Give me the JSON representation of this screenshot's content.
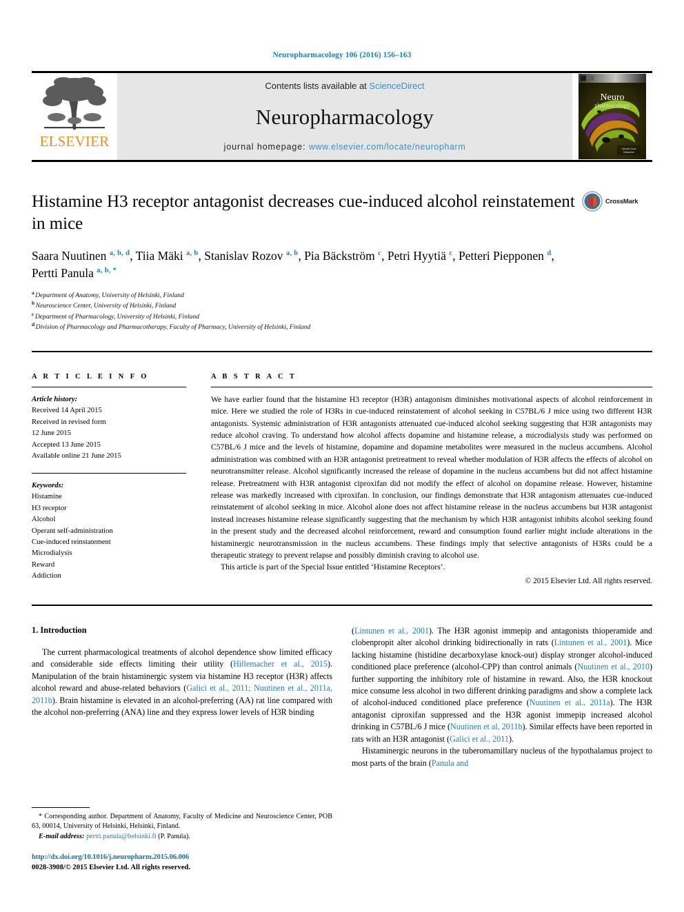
{
  "running_head": "Neuropharmacology 106 (2016) 156–163",
  "masthead": {
    "publisher_name": "ELSEVIER",
    "contents_prefix": "Contents lists available at ",
    "contents_link": "ScienceDirect",
    "journal_name": "Neuropharmacology",
    "homepage_prefix": "journal homepage: ",
    "homepage_url": "www.elsevier.com/locate/neuropharm",
    "cover_title_line1": "Neuro",
    "cover_title_line2": "pharmacology"
  },
  "article": {
    "title": "Histamine H3 receptor antagonist decreases cue-induced alcohol reinstatement in mice",
    "crossmark_label": "CrossMark",
    "authors": [
      {
        "name": "Saara Nuutinen",
        "marks": "a, b, d",
        "sep": ", "
      },
      {
        "name": "Tiia Mäki",
        "marks": "a, b",
        "sep": ", "
      },
      {
        "name": "Stanislav Rozov",
        "marks": "a, b",
        "sep": ", "
      },
      {
        "name": "Pia Bäckström",
        "marks": "c",
        "sep": ", "
      },
      {
        "name": "Petri Hyytiä",
        "marks": "c",
        "sep": ", "
      },
      {
        "name": "Petteri Piepponen",
        "marks": "d",
        "sep": ", "
      },
      {
        "name": "Pertti Panula",
        "marks": "a, b, *",
        "sep": ""
      }
    ],
    "affiliations": [
      {
        "mark": "a",
        "text": "Department of Anatomy, University of Helsinki, Finland"
      },
      {
        "mark": "b",
        "text": "Neuroscience Center, University of Helsinki, Finland"
      },
      {
        "mark": "c",
        "text": "Department of Pharmacology, University of Helsinki, Finland"
      },
      {
        "mark": "d",
        "text": "Division of Pharmacology and Pharmacotherapy, Faculty of Pharmacy, University of Helsinki, Finland"
      }
    ]
  },
  "article_info": {
    "label": "A R T I C L E   I N F O",
    "history_heading": "Article history:",
    "history": [
      "Received 14 April 2015",
      "Received in revised form",
      "12 June 2015",
      "Accepted 13 June 2015",
      "Available online 21 June 2015"
    ],
    "keywords_heading": "Keywords:",
    "keywords": [
      "Histamine",
      "H3 receptor",
      "Alcohol",
      "Operant self-administration",
      "Cue-induced reinstatement",
      "Microdialysis",
      "Reward",
      "Addiction"
    ]
  },
  "abstract": {
    "label": "A B S T R A C T",
    "paragraph1": "We have earlier found that the histamine H3 receptor (H3R) antagonism diminishes motivational aspects of alcohol reinforcement in mice. Here we studied the role of H3Rs in cue-induced reinstatement of alcohol seeking in C57BL/6 J mice using two different H3R antagonists. Systemic administration of H3R antagonists attenuated cue-induced alcohol seeking suggesting that H3R antagonists may reduce alcohol craving. To understand how alcohol affects dopamine and histamine release, a microdialysis study was performed on C57BL/6 J mice and the levels of histamine, dopamine and dopamine metabolites were measured in the nucleus accumbens. Alcohol administration was combined with an H3R antagonist pretreatment to reveal whether modulation of H3R affects the effects of alcohol on neurotransmitter release. Alcohol significantly increased the release of dopamine in the nucleus accumbens but did not affect histamine release. Pretreatment with H3R antagonist ciproxifan did not modify the effect of alcohol on dopamine release. However, histamine release was markedly increased with ciproxifan. In conclusion, our findings demonstrate that H3R antagonism attenuates cue-induced reinstatement of alcohol seeking in mice. Alcohol alone does not affect histamine release in the nucleus accumbens but H3R antagonist instead increases histamine release significantly suggesting that the mechanism by which H3R antagonist inhibits alcohol seeking found in the present study and the decreased alcohol reinforcement, reward and consumption found earlier might include alterations in the histaminergic neurotransmission in the nucleus accumbens. These findings imply that selective antagonists of H3Rs could be a therapeutic strategy to prevent relapse and possibly diminish craving to alcohol use.",
    "paragraph2": "This article is part of the Special Issue entitled ‘Histamine Receptors’.",
    "copyright": "© 2015 Elsevier Ltd. All rights reserved."
  },
  "introduction": {
    "heading": "1. Introduction",
    "left_col": [
      {
        "t": "The current pharmacological treatments of alcohol dependence show limited efficacy and considerable side effects limiting their utility (",
        "c": ""
      },
      {
        "t": "",
        "c": "Hillemacher et al., 2015"
      },
      {
        "t": "). Manipulation of the brain histaminergic system via histamine H3 receptor (H3R) affects alcohol reward and abuse-related behaviors (",
        "c": ""
      },
      {
        "t": "",
        "c": "Galici et al., 2011; Nuutinen et al., 2011a, 2011b"
      },
      {
        "t": "). Brain histamine is elevated in an alcohol-preferring (AA) rat line compared with the alcohol non-preferring (ANA) line and they express lower levels of H3R binding",
        "c": ""
      }
    ],
    "right_col": [
      {
        "t": "(",
        "c": ""
      },
      {
        "t": "",
        "c": "Lintunen et al., 2001"
      },
      {
        "t": "). The H3R agonist immepip and antagonists thioperamide and clobenpropit alter alcohol drinking bidirectionally in rats (",
        "c": ""
      },
      {
        "t": "",
        "c": "Lintunen et al., 2001"
      },
      {
        "t": "). Mice lacking histamine (histidine decarboxylase knock-out) display stronger alcohol-induced conditioned place preference (alcohol-CPP) than control animals (",
        "c": ""
      },
      {
        "t": "",
        "c": "Nuutinen et al., 2010"
      },
      {
        "t": ") further supporting the inhibitory role of histamine in reward. Also, the H3R knockout mice consume less alcohol in two different drinking paradigms and show a complete lack of alcohol-induced conditioned place preference (",
        "c": ""
      },
      {
        "t": "",
        "c": "Nuutinen et al., 2011a"
      },
      {
        "t": "). The H3R antagonist ciproxifan suppressed and the H3R agonist immepip increased alcohol drinking in C57BL/6 J mice (",
        "c": ""
      },
      {
        "t": "",
        "c": "Nuutinen et al, 2011b"
      },
      {
        "t": "). Similar effects have been reported in rats with an H3R antagonist (",
        "c": ""
      },
      {
        "t": "",
        "c": "Galici et al., 2011"
      },
      {
        "t": ").",
        "c": ""
      }
    ],
    "right_col_p2": [
      {
        "t": "Histaminergic neurons in the tuberomamillary nucleus of the hypothalamus project to most parts of the brain (",
        "c": ""
      },
      {
        "t": "",
        "c": "Panula and"
      }
    ]
  },
  "footnote": {
    "corresponding": "* Corresponding author. Department of Anatomy, Faculty of Medicine and Neuroscience Center, POB 63, 00014, University of Helsinki, Helsinki, Finland.",
    "email_label": "E-mail address:",
    "email": "pertti.panula@helsinki.fi",
    "email_suffix": "(P. Panula).",
    "doi": "http://dx.doi.org/10.1016/j.neuropharm.2015.06.006",
    "issn_line": "0028-3908/© 2015 Elsevier Ltd. All rights reserved."
  },
  "colors": {
    "link_blue": "#1a7fba",
    "sciencedirect_blue": "#3a8fc4",
    "elsevier_orange": "#F08C1E"
  }
}
